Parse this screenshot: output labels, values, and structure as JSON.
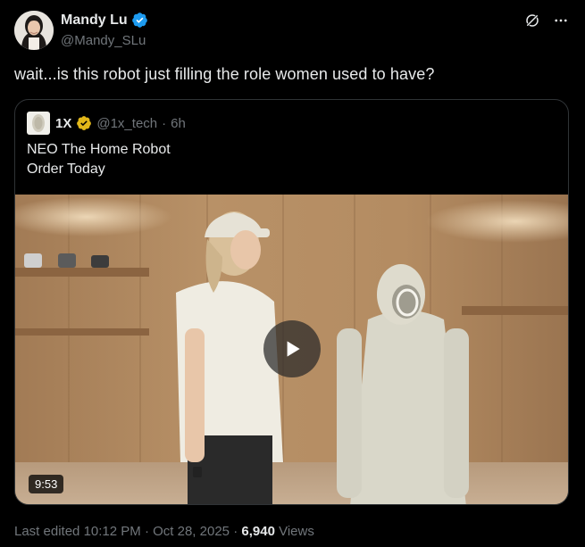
{
  "author": {
    "display_name": "Mandy Lu",
    "handle": "@Mandy_SLu",
    "verified": true
  },
  "icons": {
    "grok": "grok-icon",
    "more": "more-icon",
    "verified": "verified-badge-icon",
    "play": "play-icon"
  },
  "colors": {
    "background": "#000000",
    "text": "#e7e9ea",
    "muted": "#71767b",
    "verified_blue": "#1d9bf0",
    "verified_gold": "#e2b719",
    "border": "#2f3336"
  },
  "tweet": {
    "text": "wait...is this robot just filling the role women used to have?"
  },
  "quote": {
    "display_name": "1X",
    "handle": "@1x_tech",
    "separator": "·",
    "time": "6h",
    "lines": [
      "NEO The Home Robot",
      "Order Today"
    ],
    "video": {
      "duration": "9:53"
    }
  },
  "meta": {
    "edited_prefix": "Last edited",
    "time": "10:12 PM",
    "separator1": "·",
    "date": "Oct 28, 2025",
    "separator2": "·",
    "views_count": "6,940",
    "views_label": "Views"
  }
}
